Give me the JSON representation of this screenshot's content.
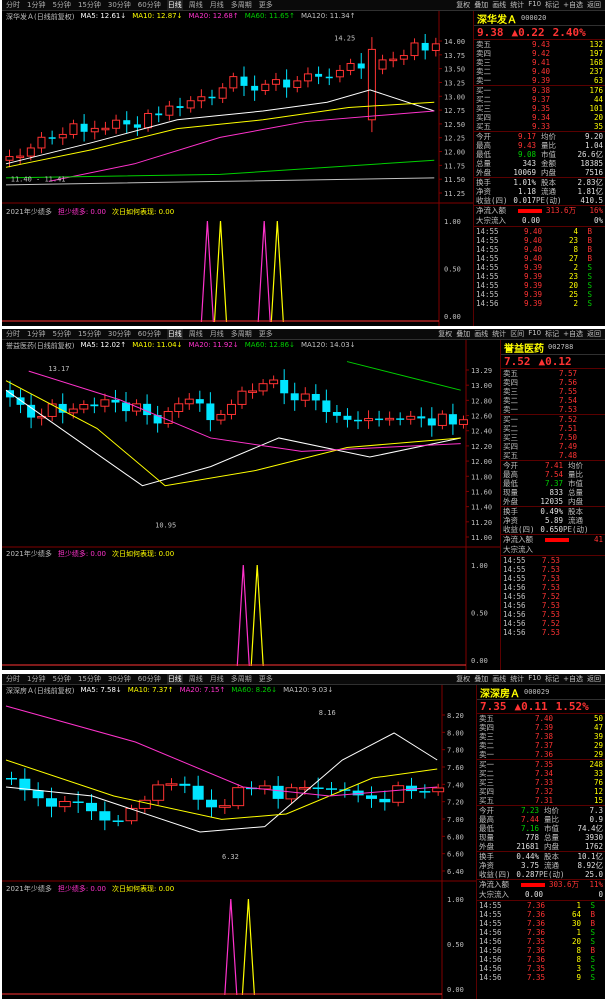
{
  "toolbar_common": [
    "分时",
    "1分钟",
    "5分钟",
    "15分钟",
    "30分钟",
    "60分钟",
    "日线",
    "周线",
    "月线",
    "多周期",
    "更多"
  ],
  "toolbar_right": [
    "复权",
    "叠加",
    "画线",
    "统计",
    "F10",
    "标记",
    "+自选",
    "返回"
  ],
  "toolbar_right2": [
    "复权",
    "叠加",
    "画线",
    "统计",
    "区间",
    "F10",
    "标记",
    "+自选",
    "返回"
  ],
  "panels": [
    {
      "id": "p1",
      "name": "深华发Ａ",
      "code": "000020",
      "price": "9.38",
      "change": "▲0.22",
      "pct": "2.40%",
      "legend": [
        {
          "text": "深华发Ａ(日线前复权)",
          "color": "#c0c0c0"
        },
        {
          "text": "MA5: 12.61↓",
          "color": "#ffffff"
        },
        {
          "text": "MA10: 12.87↓",
          "color": "#ffff00"
        },
        {
          "text": "MA20: 12.68↑",
          "color": "#ff33cc"
        },
        {
          "text": "MA60: 11.65↑",
          "color": "#00d000"
        },
        {
          "text": "MA120: 11.34↑",
          "color": "#c0c0c0"
        }
      ],
      "ind_legend": [
        {
          "text": "2021年少绩多",
          "color": "#c0c0c0"
        },
        {
          "text": "担少绩多: 0.00",
          "color": "#ff33cc"
        },
        {
          "text": "次日如何表现: 0.00",
          "color": "#ffff00"
        }
      ],
      "price_axis": [
        "14.00",
        "13.75",
        "13.50",
        "13.25",
        "13.00",
        "12.75",
        "12.50",
        "12.25",
        "12.00",
        "11.75",
        "11.50",
        "11.25"
      ],
      "ind_axis": [
        "1.00",
        "0.50",
        "0.00"
      ],
      "annotations": [
        {
          "text": "14.25"
        },
        {
          "text": "11.40 - 11.41"
        }
      ],
      "sell": [
        [
          "卖五",
          "9.43",
          "132"
        ],
        [
          "卖四",
          "9.42",
          "197"
        ],
        [
          "卖三",
          "9.41",
          "168"
        ],
        [
          "卖二",
          "9.40",
          "237"
        ],
        [
          "卖一",
          "9.39",
          "63"
        ]
      ],
      "buy": [
        [
          "买一",
          "9.38",
          "176"
        ],
        [
          "买二",
          "9.37",
          "44"
        ],
        [
          "买三",
          "9.35",
          "101"
        ],
        [
          "买四",
          "9.34",
          "20"
        ],
        [
          "买五",
          "9.33",
          "35"
        ]
      ],
      "stats": [
        [
          "今开",
          "9.17",
          "均价",
          "9.20"
        ],
        [
          "最高",
          "9.43",
          "量比",
          "1.04"
        ],
        [
          "最低",
          "9.08",
          "市值",
          "26.6亿"
        ],
        [
          "总量",
          "343",
          "金额",
          "18385"
        ],
        [
          "外盘",
          "10069",
          "内盘",
          "7516"
        ],
        [
          "换手",
          "1.01%",
          "股本",
          "2.83亿"
        ],
        [
          "净资",
          "1.18",
          "流通",
          "1.81亿"
        ],
        [
          "收益(四)",
          "0.017",
          "PE(动)",
          "410.5"
        ]
      ],
      "flow": [
        [
          "净流入额",
          "313.6万",
          "16%"
        ],
        [
          "大宗流入",
          "0.00",
          "0%"
        ]
      ],
      "ticks": [
        [
          "14:55",
          "9.40",
          "4",
          "B"
        ],
        [
          "14:55",
          "9.40",
          "23",
          "B"
        ],
        [
          "14:55",
          "9.40",
          "8",
          "B"
        ],
        [
          "14:55",
          "9.40",
          "27",
          "B"
        ],
        [
          "14:55",
          "9.39",
          "2",
          "S"
        ],
        [
          "14:55",
          "9.39",
          "23",
          "S"
        ],
        [
          "14:55",
          "9.39",
          "20",
          "S"
        ],
        [
          "14:55",
          "9.39",
          "25",
          "S"
        ],
        [
          "14:56",
          "9.39",
          "2",
          "S"
        ]
      ]
    },
    {
      "id": "p2",
      "name": "誉益医药",
      "code": "002788",
      "price": "7.52",
      "change": "▲0.12",
      "pct": "",
      "legend": [
        {
          "text": "誉益医药(日线前复权)",
          "color": "#c0c0c0"
        },
        {
          "text": "MA5: 12.02↑",
          "color": "#ffffff"
        },
        {
          "text": "MA10: 11.04↓",
          "color": "#ffff00"
        },
        {
          "text": "MA20: 11.92↓",
          "color": "#ff33cc"
        },
        {
          "text": "MA60: 12.86↓",
          "color": "#00d000"
        },
        {
          "text": "MA120: 14.03↓",
          "color": "#c0c0c0"
        }
      ],
      "ind_legend": [
        {
          "text": "2021年少绩多",
          "color": "#c0c0c0"
        },
        {
          "text": "担少绩多: 0.00",
          "color": "#ff33cc"
        },
        {
          "text": "次日如何表现: 0.00",
          "color": "#ffff00"
        }
      ],
      "price_axis": [
        "13.29",
        "13.00",
        "12.80",
        "12.60",
        "12.40",
        "12.20",
        "12.00",
        "11.80",
        "11.60",
        "11.40",
        "11.20",
        "11.00"
      ],
      "ind_axis": [
        "1.00",
        "0.50",
        "0.00"
      ],
      "annotations": [
        {
          "text": "13.17"
        },
        {
          "text": "10.95"
        }
      ],
      "sell": [
        [
          "卖五",
          "",
          "7.57"
        ],
        [
          "卖四",
          "",
          "7.56"
        ],
        [
          "卖三",
          "",
          "7.55"
        ],
        [
          "卖二",
          "",
          "7.54"
        ],
        [
          "卖一",
          "",
          "7.53"
        ]
      ],
      "buy": [
        [
          "买一",
          "",
          "7.52"
        ],
        [
          "买二",
          "",
          "7.51"
        ],
        [
          "买三",
          "",
          "7.50"
        ],
        [
          "买四",
          "",
          "7.49"
        ],
        [
          "买五",
          "",
          "7.48"
        ]
      ],
      "stats": [
        [
          "今开",
          "7.41",
          "均价",
          ""
        ],
        [
          "最高",
          "7.54",
          "量比",
          ""
        ],
        [
          "最低",
          "7.37",
          "市值",
          ""
        ],
        [
          "现量",
          "833",
          "总量",
          ""
        ],
        [
          "外盘",
          "12035",
          "内盘",
          ""
        ],
        [
          "换手",
          "0.49%",
          "股本",
          ""
        ],
        [
          "净资",
          "5.89",
          "流通",
          ""
        ],
        [
          "收益(四)",
          "0.650",
          "PE(动)",
          ""
        ]
      ],
      "flow": [
        [
          "净流入额",
          "",
          "41"
        ],
        [
          "大宗流入",
          "",
          ""
        ]
      ],
      "ticks": [
        [
          "14:55",
          "7.53",
          "",
          ""
        ],
        [
          "14:55",
          "7.53",
          "",
          ""
        ],
        [
          "14:55",
          "7.53",
          "",
          ""
        ],
        [
          "14:56",
          "7.53",
          "",
          ""
        ],
        [
          "14:56",
          "7.52",
          "",
          ""
        ],
        [
          "14:56",
          "7.53",
          "",
          ""
        ],
        [
          "14:56",
          "7.53",
          "",
          ""
        ],
        [
          "14:56",
          "7.52",
          "",
          ""
        ],
        [
          "14:56",
          "7.53",
          "",
          ""
        ]
      ]
    },
    {
      "id": "p3",
      "name": "深深房Ａ",
      "code": "000029",
      "price": "7.35",
      "change": "▲0.11",
      "pct": "1.52%",
      "legend": [
        {
          "text": "深深房Ａ(日线前复权)",
          "color": "#c0c0c0"
        },
        {
          "text": "MA5: 7.58↓",
          "color": "#ffffff"
        },
        {
          "text": "MA10: 7.37↑",
          "color": "#ffff00"
        },
        {
          "text": "MA20: 7.15↑",
          "color": "#ff33cc"
        },
        {
          "text": "MA60: 8.26↓",
          "color": "#00d000"
        },
        {
          "text": "MA120: 9.03↓",
          "color": "#c0c0c0"
        }
      ],
      "ind_legend": [
        {
          "text": "2021年少绩多",
          "color": "#c0c0c0"
        },
        {
          "text": "担少绩多: 0.00",
          "color": "#ff33cc"
        },
        {
          "text": "次日如何表现: 0.00",
          "color": "#ffff00"
        }
      ],
      "price_axis": [
        "8.20",
        "8.00",
        "7.80",
        "7.60",
        "7.40",
        "7.20",
        "7.00",
        "6.80",
        "6.60",
        "6.40"
      ],
      "ind_axis": [
        "1.00",
        "0.50",
        "0.00"
      ],
      "annotations": [
        {
          "text": "8.16"
        },
        {
          "text": "6.32"
        }
      ],
      "sell": [
        [
          "卖五",
          "7.40",
          "50"
        ],
        [
          "卖四",
          "7.39",
          "47"
        ],
        [
          "卖三",
          "7.38",
          "39"
        ],
        [
          "卖二",
          "7.37",
          "29"
        ],
        [
          "卖一",
          "7.36",
          "29"
        ]
      ],
      "buy": [
        [
          "买一",
          "7.35",
          "248"
        ],
        [
          "买二",
          "7.34",
          "33"
        ],
        [
          "买三",
          "7.33",
          "76"
        ],
        [
          "买四",
          "7.32",
          "12"
        ],
        [
          "买五",
          "7.31",
          "15"
        ]
      ],
      "stats": [
        [
          "今开",
          "7.23",
          "均价",
          "7.3"
        ],
        [
          "最高",
          "7.44",
          "量比",
          "0.9"
        ],
        [
          "最低",
          "7.16",
          "市值",
          "74.4亿"
        ],
        [
          "现量",
          "778",
          "总量",
          "3930"
        ],
        [
          "外盘",
          "21681",
          "内盘",
          "1762"
        ],
        [
          "换手",
          "0.44%",
          "股本",
          "10.1亿"
        ],
        [
          "净资",
          "3.75",
          "流通",
          "8.92亿"
        ],
        [
          "收益(四)",
          "0.287",
          "PE(动)",
          "25.0"
        ]
      ],
      "flow": [
        [
          "净流入额",
          "303.6万",
          "11%"
        ],
        [
          "大宗流入",
          "0.00",
          "0"
        ]
      ],
      "ticks": [
        [
          "14:55",
          "7.36",
          "1",
          "S"
        ],
        [
          "14:55",
          "7.36",
          "64",
          "B"
        ],
        [
          "14:55",
          "7.36",
          "30",
          "B"
        ],
        [
          "14:56",
          "7.36",
          "1",
          "S"
        ],
        [
          "14:56",
          "7.35",
          "20",
          "S"
        ],
        [
          "14:56",
          "7.36",
          "8",
          "B"
        ],
        [
          "14:56",
          "7.36",
          "8",
          "S"
        ],
        [
          "14:56",
          "7.35",
          "3",
          "S"
        ],
        [
          "14:56",
          "7.35",
          "9",
          "S"
        ]
      ]
    }
  ]
}
